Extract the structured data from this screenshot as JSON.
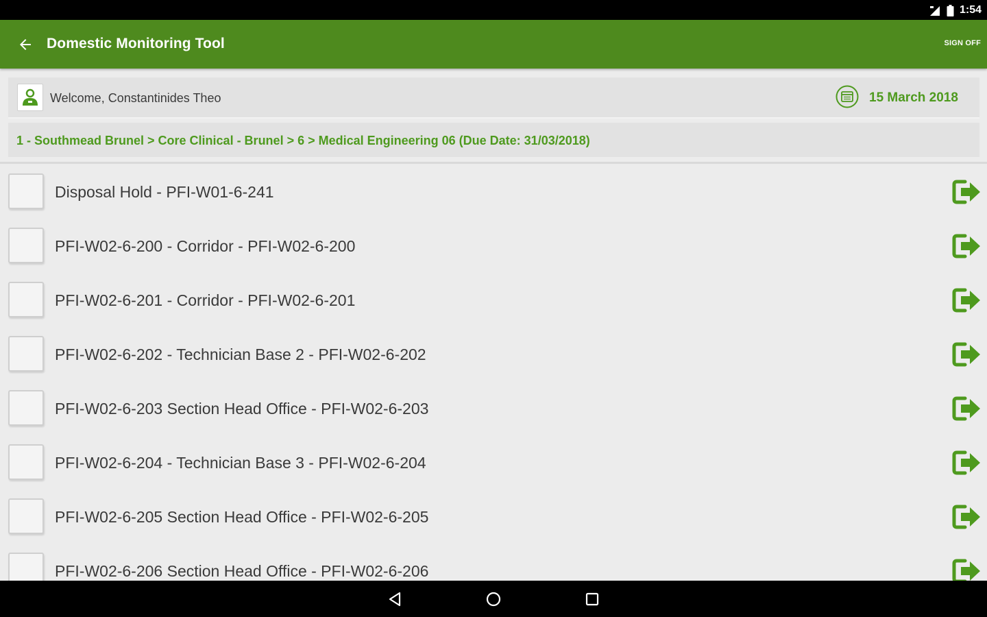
{
  "status_bar": {
    "time": "1:54"
  },
  "app_bar": {
    "title": "Domestic Monitoring Tool",
    "sign_off_label": "SIGN OFF"
  },
  "welcome": {
    "text": "Welcome, Constantinides Theo",
    "date": "15 March 2018"
  },
  "breadcrumb": "1 - Southmead Brunel > Core Clinical - Brunel > 6 > Medical Engineering 06 (Due Date: 31/03/2018)",
  "items": [
    {
      "label": "Disposal Hold - PFI-W01-6-241"
    },
    {
      "label": "PFI-W02-6-200 - Corridor - PFI-W02-6-200"
    },
    {
      "label": "PFI-W02-6-201 - Corridor - PFI-W02-6-201"
    },
    {
      "label": "PFI-W02-6-202 - Technician Base 2 - PFI-W02-6-202"
    },
    {
      "label": "PFI-W02-6-203 Section Head Office - PFI-W02-6-203"
    },
    {
      "label": "PFI-W02-6-204 - Technician Base 3 - PFI-W02-6-204"
    },
    {
      "label": "PFI-W02-6-205 Section Head Office - PFI-W02-6-205"
    },
    {
      "label": "PFI-W02-6-206 Section Head Office - PFI-W02-6-206"
    }
  ],
  "colors": {
    "app_bar": "#4e8a1e",
    "accent_green": "#4e9a1e",
    "background": "#ececec"
  },
  "icons": {
    "back": "arrow-left-icon",
    "user": "user-icon",
    "calendar": "calendar-icon",
    "item_action": "exit-arrow-icon"
  }
}
